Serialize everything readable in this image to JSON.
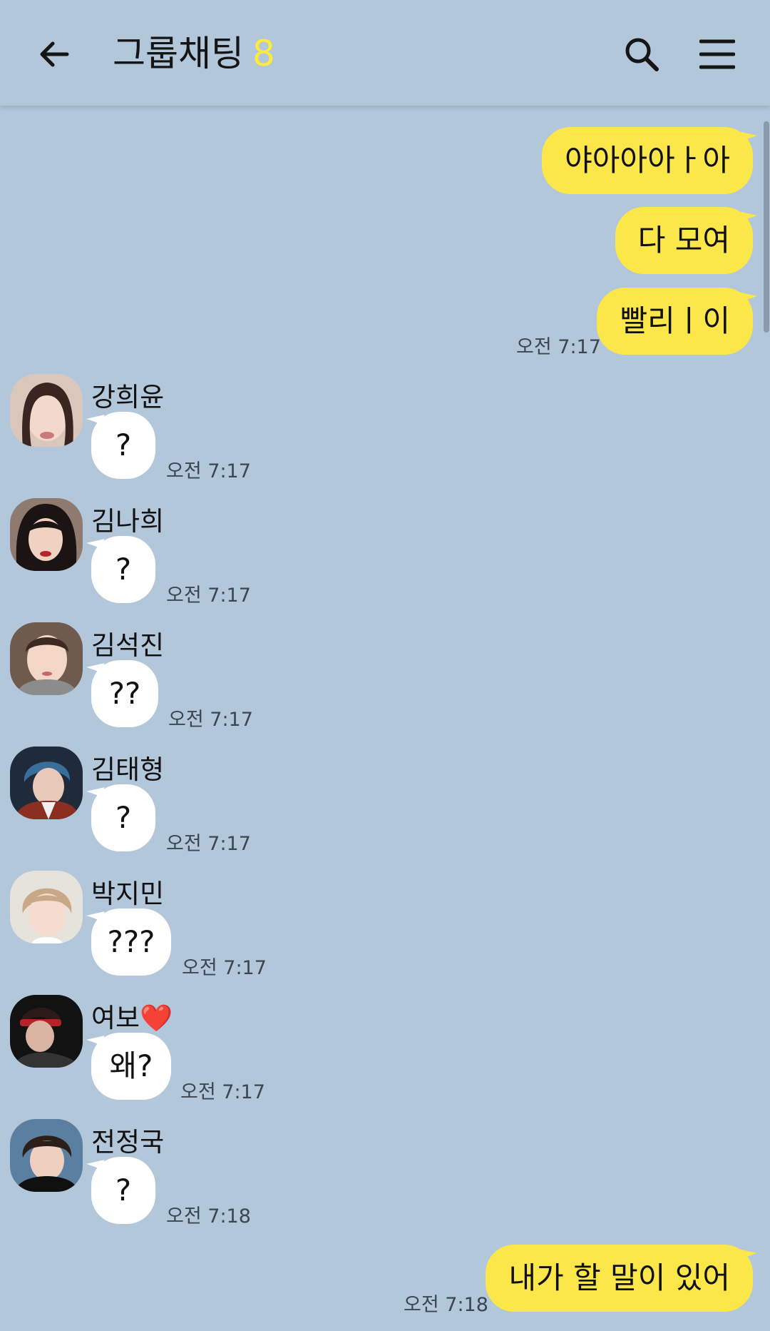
{
  "header": {
    "title": "그룹채팅",
    "member_count": "8",
    "icons": {
      "back": "back-arrow-icon",
      "search": "search-icon",
      "menu": "hamburger-menu-icon"
    }
  },
  "colors": {
    "background": "#b2c7da",
    "my_bubble": "#fbe74a",
    "their_bubble": "#ffffff",
    "count_accent": "#fbeb3b"
  },
  "messages_top": [
    {
      "text": "야아아아ㅏ아"
    },
    {
      "text": "다 모여"
    },
    {
      "text": "빨리ㅣ이",
      "time": "오전 7:17"
    }
  ],
  "others": [
    {
      "sender": "강희윤",
      "text": "?",
      "time": "오전 7:17"
    },
    {
      "sender": "김나희",
      "text": "?",
      "time": "오전 7:17"
    },
    {
      "sender": "김석진",
      "text": "??",
      "time": "오전 7:17"
    },
    {
      "sender": "김태형",
      "text": "?",
      "time": "오전 7:17"
    },
    {
      "sender": "박지민",
      "text": "???",
      "time": "오전 7:17"
    },
    {
      "sender": "여보❤️",
      "text": "왜?",
      "time": "오전 7:17"
    },
    {
      "sender": "전정국",
      "text": "?",
      "time": "오전 7:18"
    }
  ],
  "last_message": {
    "text": "내가 할 말이 있어",
    "time": "오전 7:18"
  }
}
